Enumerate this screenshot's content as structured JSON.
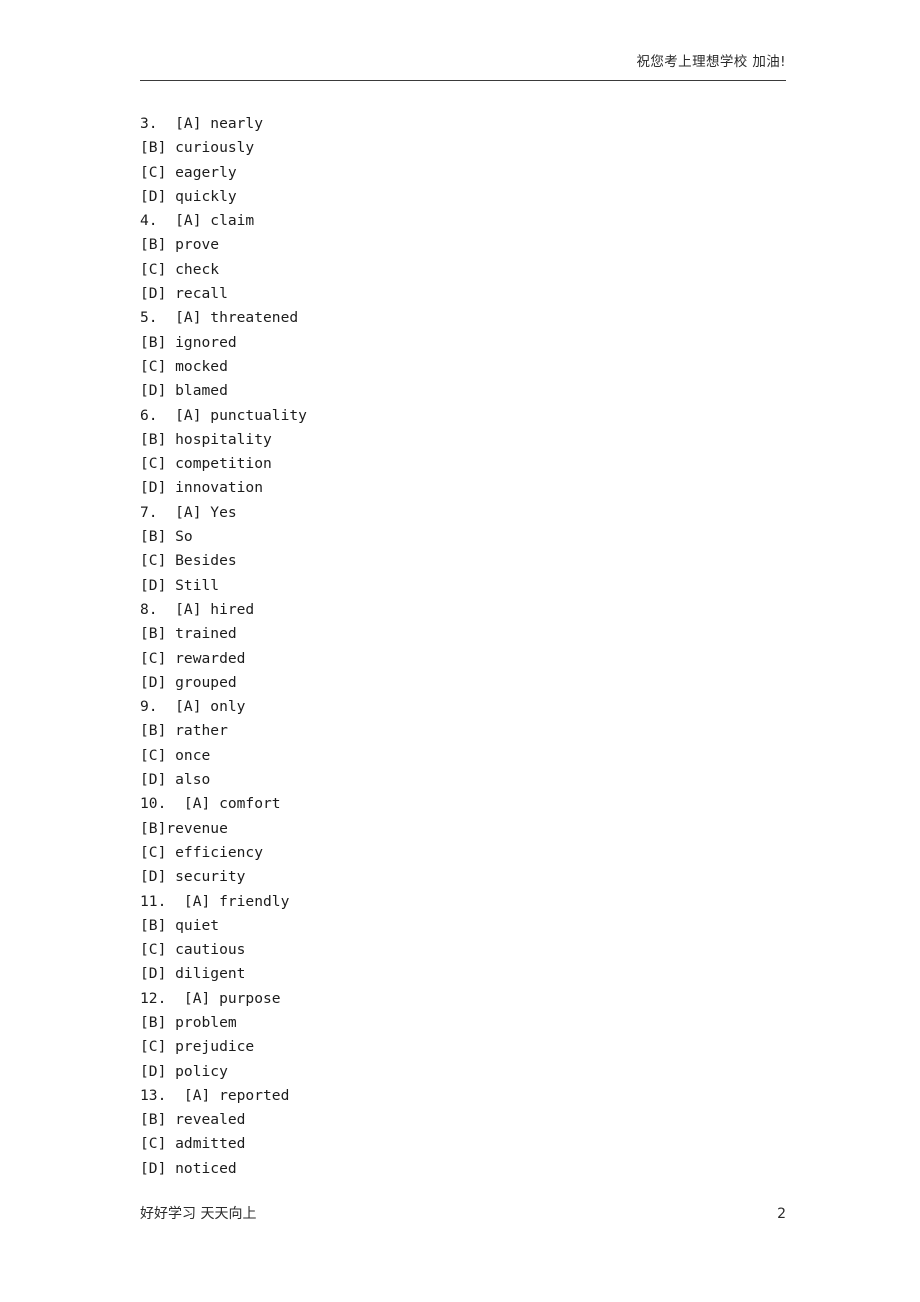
{
  "header": {
    "right_text": "祝您考上理想学校 加油!"
  },
  "footer": {
    "left_text": "好好学习 天天向上",
    "page_number": "2"
  },
  "content": {
    "lines": [
      "3.  [A] nearly",
      "[B] curiously",
      "[C] eagerly",
      "[D] quickly",
      "4.  [A] claim",
      "[B] prove",
      "[C] check",
      "[D] recall",
      "5.  [A] threatened",
      "[B] ignored",
      "[C] mocked",
      "[D] blamed",
      "6.  [A] punctuality",
      "[B] hospitality",
      "[C] competition",
      "[D] innovation",
      "7.  [A] Yes",
      "[B] So",
      "[C] Besides",
      "[D] Still",
      "8.  [A] hired",
      "[B] trained",
      "[C] rewarded",
      "[D] grouped",
      "9.  [A] only",
      "[B] rather",
      "[C] once",
      "[D] also",
      "10.  [A] comfort",
      "[B]revenue",
      "[C] efficiency",
      "[D] security",
      "11.  [A] friendly",
      "[B] quiet",
      "[C] cautious",
      "[D] diligent",
      "12.  [A] purpose",
      "[B] problem",
      "[C] prejudice",
      "[D] policy",
      "13.  [A] reported",
      "[B] revealed",
      "[C] admitted",
      "[D] noticed"
    ]
  },
  "questions": [
    {
      "number": "3.",
      "options": [
        {
          "label": "[A]",
          "text": "nearly"
        },
        {
          "label": "[B]",
          "text": "curiously"
        },
        {
          "label": "[C]",
          "text": "eagerly"
        },
        {
          "label": "[D]",
          "text": "quickly"
        }
      ]
    },
    {
      "number": "4.",
      "options": [
        {
          "label": "[A]",
          "text": "claim"
        },
        {
          "label": "[B]",
          "text": "prove"
        },
        {
          "label": "[C]",
          "text": "check"
        },
        {
          "label": "[D]",
          "text": "recall"
        }
      ]
    },
    {
      "number": "5.",
      "options": [
        {
          "label": "[A]",
          "text": "threatened"
        },
        {
          "label": "[B]",
          "text": "ignored"
        },
        {
          "label": "[C]",
          "text": "mocked"
        },
        {
          "label": "[D]",
          "text": "blamed"
        }
      ]
    },
    {
      "number": "6.",
      "options": [
        {
          "label": "[A]",
          "text": "punctuality"
        },
        {
          "label": "[B]",
          "text": "hospitality"
        },
        {
          "label": "[C]",
          "text": "competition"
        },
        {
          "label": "[D]",
          "text": "innovation"
        }
      ]
    },
    {
      "number": "7.",
      "options": [
        {
          "label": "[A]",
          "text": "Yes"
        },
        {
          "label": "[B]",
          "text": "So"
        },
        {
          "label": "[C]",
          "text": "Besides"
        },
        {
          "label": "[D]",
          "text": "Still"
        }
      ]
    },
    {
      "number": "8.",
      "options": [
        {
          "label": "[A]",
          "text": "hired"
        },
        {
          "label": "[B]",
          "text": "trained"
        },
        {
          "label": "[C]",
          "text": "rewarded"
        },
        {
          "label": "[D]",
          "text": "grouped"
        }
      ]
    },
    {
      "number": "9.",
      "options": [
        {
          "label": "[A]",
          "text": "only"
        },
        {
          "label": "[B]",
          "text": "rather"
        },
        {
          "label": "[C]",
          "text": "once"
        },
        {
          "label": "[D]",
          "text": "also"
        }
      ]
    },
    {
      "number": "10.",
      "options": [
        {
          "label": "[A]",
          "text": "comfort"
        },
        {
          "label": "[B]",
          "text": "revenue"
        },
        {
          "label": "[C]",
          "text": "efficiency"
        },
        {
          "label": "[D]",
          "text": "security"
        }
      ]
    },
    {
      "number": "11.",
      "options": [
        {
          "label": "[A]",
          "text": "friendly"
        },
        {
          "label": "[B]",
          "text": "quiet"
        },
        {
          "label": "[C]",
          "text": "cautious"
        },
        {
          "label": "[D]",
          "text": "diligent"
        }
      ]
    },
    {
      "number": "12.",
      "options": [
        {
          "label": "[A]",
          "text": "purpose"
        },
        {
          "label": "[B]",
          "text": "problem"
        },
        {
          "label": "[C]",
          "text": "prejudice"
        },
        {
          "label": "[D]",
          "text": "policy"
        }
      ]
    },
    {
      "number": "13.",
      "options": [
        {
          "label": "[A]",
          "text": "reported"
        },
        {
          "label": "[B]",
          "text": "revealed"
        },
        {
          "label": "[C]",
          "text": "admitted"
        },
        {
          "label": "[D]",
          "text": "noticed"
        }
      ]
    }
  ]
}
